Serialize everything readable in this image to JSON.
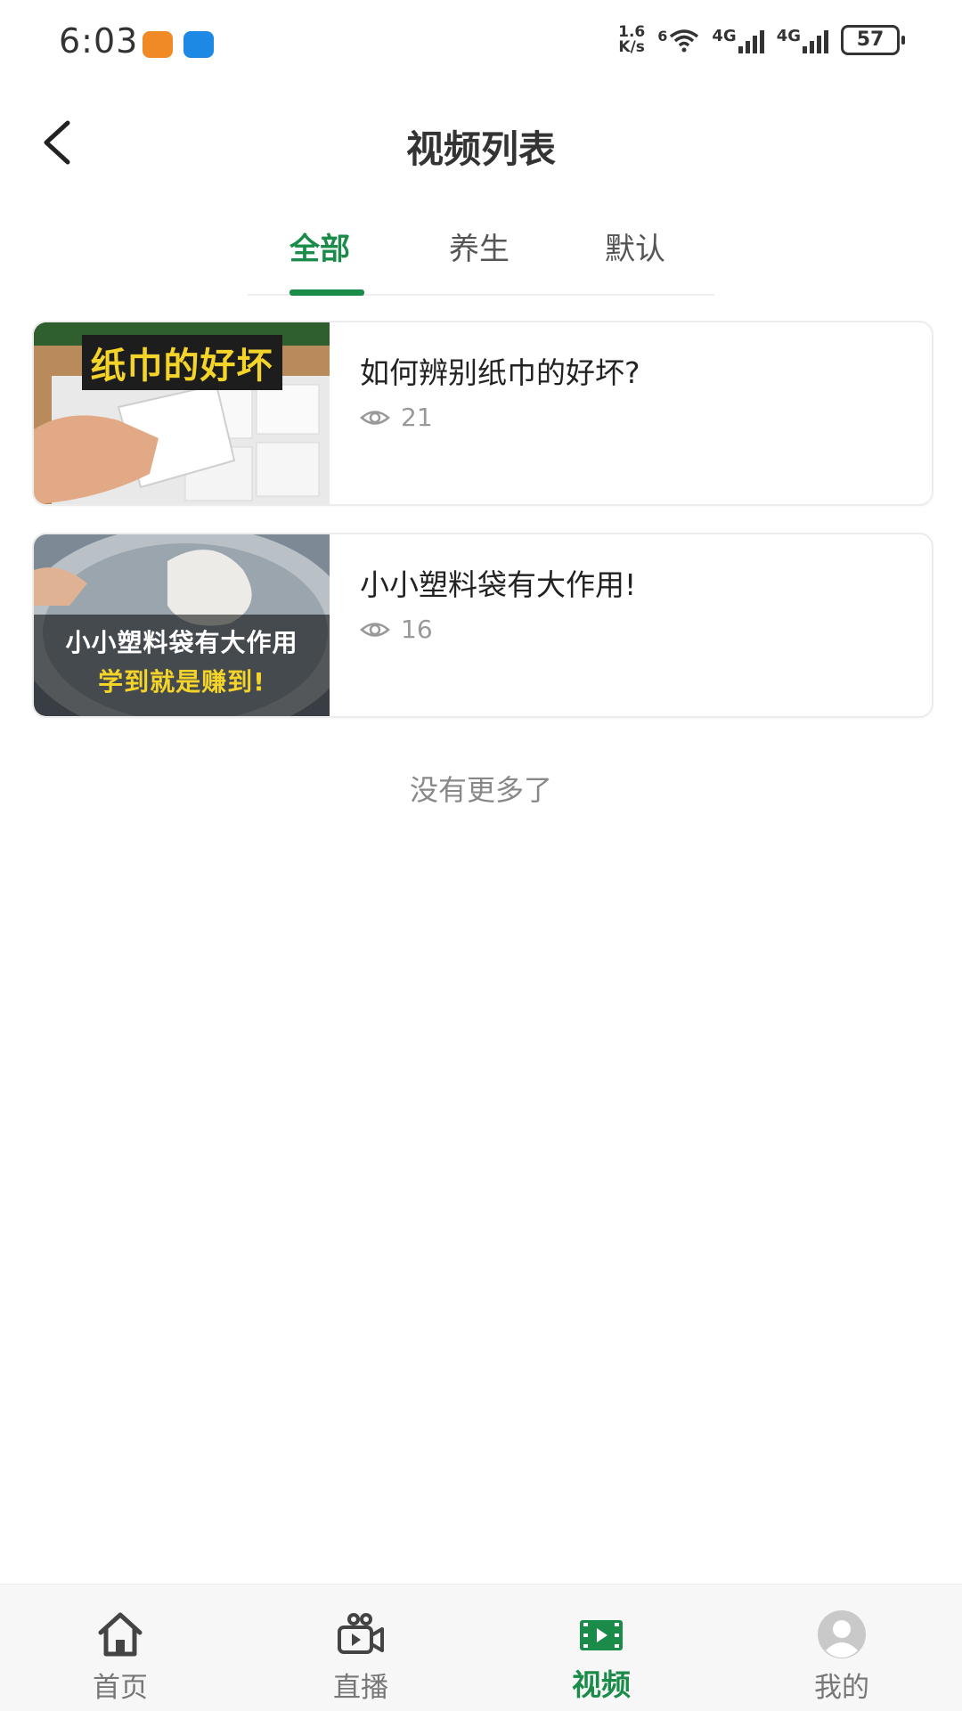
{
  "status_bar": {
    "time": "6:03",
    "net_speed_value": "1.6",
    "net_speed_unit": "K/s",
    "wifi_label": "6",
    "sim1_label": "4G",
    "sim2_label": "4G",
    "battery": "57"
  },
  "header": {
    "title": "视频列表"
  },
  "tabs": [
    {
      "label": "全部",
      "active": true
    },
    {
      "label": "养生",
      "active": false
    },
    {
      "label": "默认",
      "active": false
    }
  ],
  "videos": [
    {
      "title": "如何辨别纸巾的好坏?",
      "views": "21",
      "thumb_text": [
        "纸巾的好坏"
      ]
    },
    {
      "title": "小小塑料袋有大作用!",
      "views": "16",
      "thumb_text": [
        "小小塑料袋有大作用",
        "学到就是赚到!"
      ]
    }
  ],
  "list_end_text": "没有更多了",
  "bottom_nav": [
    {
      "label": "首页",
      "icon": "home-icon",
      "active": false
    },
    {
      "label": "直播",
      "icon": "live-camera-icon",
      "active": false
    },
    {
      "label": "视频",
      "icon": "video-film-icon",
      "active": true
    },
    {
      "label": "我的",
      "icon": "user-avatar-icon",
      "active": false
    }
  ],
  "colors": {
    "accent": "#1a8b48",
    "thumb_title_yellow": "#f5d42a"
  }
}
